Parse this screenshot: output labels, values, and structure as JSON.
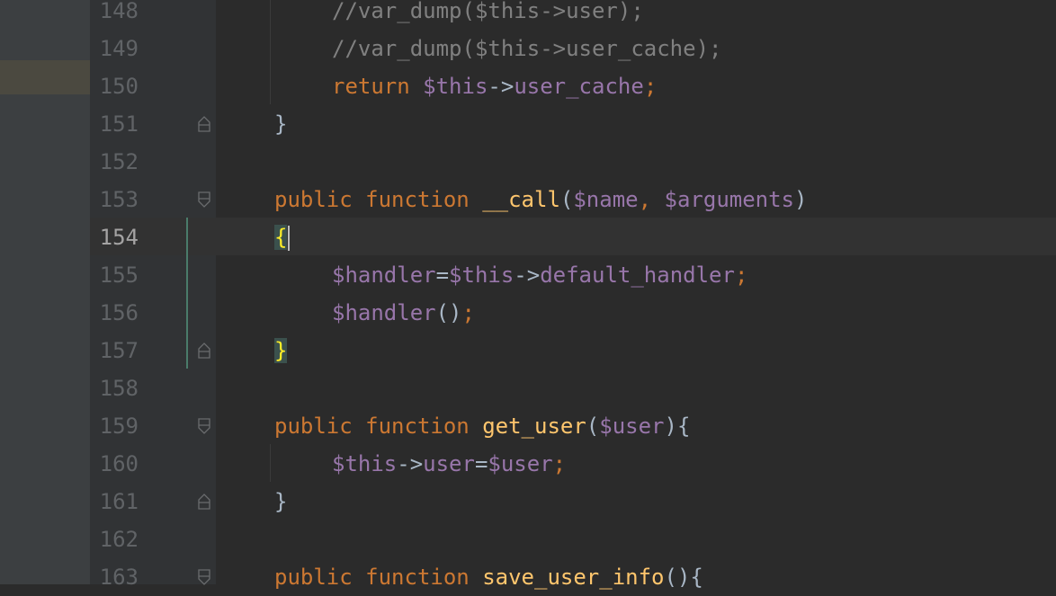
{
  "editor": {
    "current_line": "154",
    "lines": [
      {
        "number": "148",
        "text": "        //var_dump($this->user);"
      },
      {
        "number": "149",
        "text": "        //var_dump($this->user_cache);"
      },
      {
        "number": "150",
        "text": "        return $this->user_cache;"
      },
      {
        "number": "151",
        "text": "    }"
      },
      {
        "number": "152",
        "text": ""
      },
      {
        "number": "153",
        "text": "    public function __call($name, $arguments)"
      },
      {
        "number": "154",
        "text": "    {"
      },
      {
        "number": "155",
        "text": "        $handler=$this->default_handler;"
      },
      {
        "number": "156",
        "text": "        $handler();"
      },
      {
        "number": "157",
        "text": "    }"
      },
      {
        "number": "158",
        "text": ""
      },
      {
        "number": "159",
        "text": "    public function get_user($user){"
      },
      {
        "number": "160",
        "text": "        $this->user=$user;"
      },
      {
        "number": "161",
        "text": "    }"
      },
      {
        "number": "162",
        "text": ""
      },
      {
        "number": "163",
        "text": "    public function save_user_info(){"
      }
    ]
  },
  "colors": {
    "background": "#2b2b2b",
    "gutter": "#313335",
    "keyword": "#cc7832",
    "variable": "#9876aa",
    "function": "#ffc66d",
    "comment": "#808080",
    "plain": "#a9b7c6",
    "brace_highlight": "#ffef28"
  }
}
